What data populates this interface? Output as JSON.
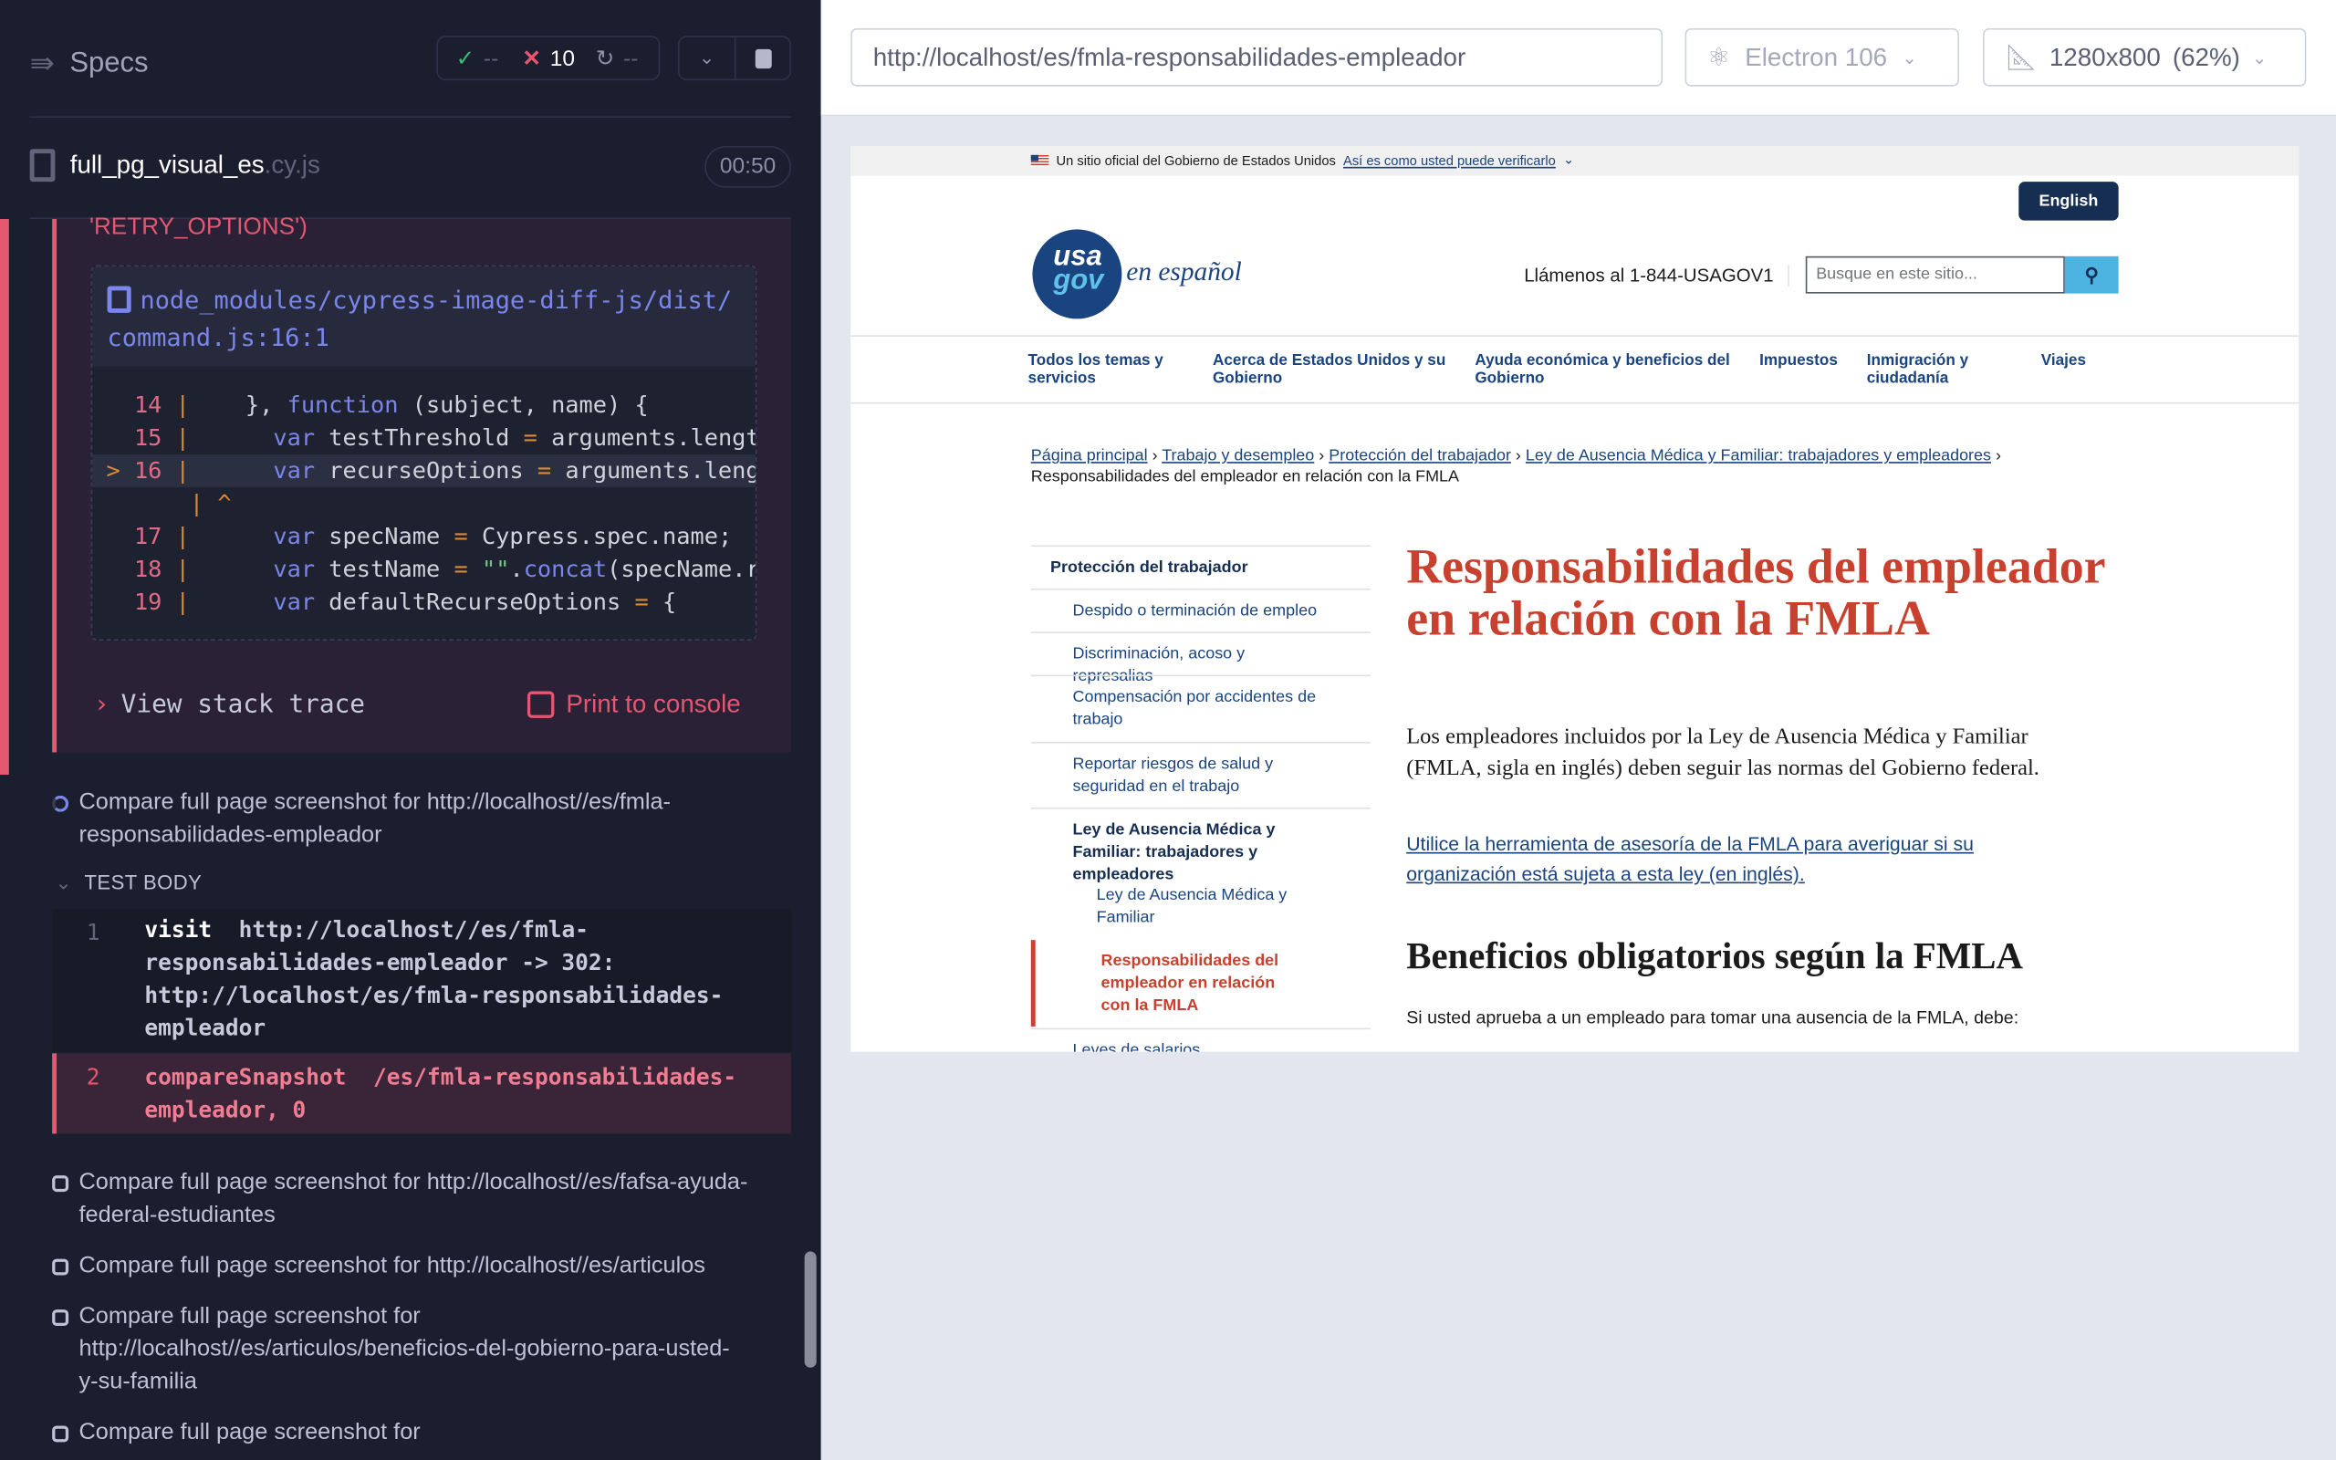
{
  "runner": {
    "header": {
      "title": "Specs",
      "passed": "--",
      "failed": "10",
      "pending": "--"
    },
    "spec": {
      "name": "full_pg_visual_es",
      "ext": ".cy.js",
      "duration": "00:50"
    },
    "error": {
      "tail": "'RETRY_OPTIONS')",
      "file_path": "node_modules/cypress-image-diff-js/dist/command.js:16:1",
      "code_lines": [
        {
          "num": "14",
          "code": "}, function (subject, name) {"
        },
        {
          "num": "15",
          "code": "var testThreshold = arguments.lengt"
        },
        {
          "num": "16",
          "code": "var recurseOptions = arguments.leng",
          "active": true
        },
        {
          "num": "17",
          "code": "var specName = Cypress.spec.name;"
        },
        {
          "num": "18",
          "code": "var testName = \"\".concat(specName.r"
        },
        {
          "num": "19",
          "code": "var defaultRecurseOptions = {"
        }
      ],
      "caret": "^",
      "view_stack_trace": "View stack trace",
      "print_to_console": "Print to console"
    },
    "current_test": "Compare full page screenshot for http://localhost//es/fmla-responsabilidades-empleador",
    "test_body_label": "TEST BODY",
    "commands": [
      {
        "num": "1",
        "name": "visit",
        "message": "http://localhost//es/fmla-responsabilidades-empleador -> 302: http://localhost/es/fmla-responsabilidades-empleador"
      },
      {
        "num": "2",
        "name": "compareSnapshot",
        "message": "/es/fmla-responsabilidades-empleador, 0",
        "failed": true
      }
    ],
    "tests": [
      "Compare full page screenshot for http://localhost//es/fafsa-ayuda-federal-estudiantes",
      "Compare full page screenshot for http://localhost//es/articulos",
      "Compare full page screenshot for http://localhost//es/articulos/beneficios-del-gobierno-para-usted-y-su-familia",
      "Compare full page screenshot for"
    ]
  },
  "browser": {
    "url": "http://localhost/es/fmla-responsabilidades-empleador",
    "browser_name": "Electron 106",
    "viewport": "1280x800",
    "scale": "(62%)"
  },
  "site": {
    "banner": {
      "text": "Un sitio oficial del Gobierno de Estados Unidos",
      "link": "Así es como usted puede verificarlo"
    },
    "english": "English",
    "logo": {
      "usa": "usa",
      "gov": "gov",
      "tag": "en español"
    },
    "phone": "Llámenos al 1-844-USAGOV1",
    "search_placeholder": "Busque en este sitio...",
    "nav": [
      "Todos los temas y servicios",
      "Acerca de Estados Unidos y su Gobierno",
      "Ayuda económica y beneficios del Gobierno",
      "Impuestos",
      "Inmigración y ciudadanía",
      "Viajes"
    ],
    "breadcrumbs": [
      "Página principal",
      "Trabajo y desempleo",
      "Protección del trabajador",
      "Ley de Ausencia Médica y Familiar: trabajadores y empleadores"
    ],
    "breadcrumb_current": "Responsabilidades del empleador en relación con la FMLA",
    "sidenav": {
      "title": "Protección del trabajador",
      "items": [
        "Despido o terminación de empleo",
        "Discriminación, acoso y represalias",
        "Compensación por accidentes de trabajo",
        "Reportar riesgos de salud y seguridad en el trabajo",
        "Ley de Ausencia Médica y Familiar: trabajadores y empleadores"
      ],
      "sub": [
        "Ley de Ausencia Médica y Familiar",
        "Responsabilidades del empleador en relación con la FMLA"
      ],
      "next": "Leyes de salarios"
    },
    "title": "Responsabilidades del empleador en relación con la FMLA",
    "intro": "Los empleadores incluidos por la Ley de Ausencia Médica y Familiar (FMLA, sigla en inglés) deben seguir las normas del Gobierno federal.",
    "tool_link": "Utilice la herramienta de asesoría de la FMLA para averiguar si su organización está sujeta a esta ley (en inglés)",
    "h2": "Beneficios obligatorios según la FMLA",
    "para": "Si usted aprueba a un empleado para tomar una ausencia de la FMLA, debe:"
  },
  "colors": {
    "accent_red": "#c8412f",
    "nav_blue": "#1a4480",
    "runner_bg": "#1b1e2e",
    "fail": "#e45770"
  }
}
